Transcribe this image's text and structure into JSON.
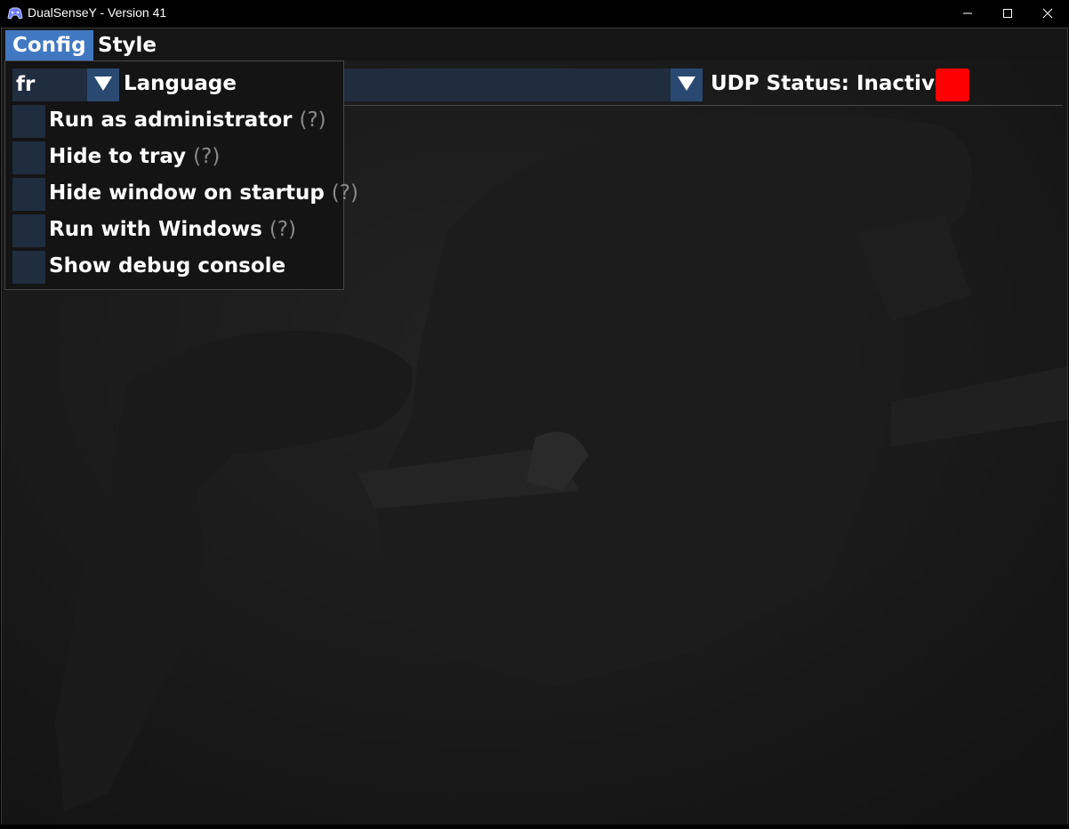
{
  "window": {
    "title": "DualSenseY - Version 41"
  },
  "menu": {
    "items": [
      {
        "label": "Config",
        "active": true
      },
      {
        "label": "Style",
        "active": false
      }
    ]
  },
  "toolbar": {
    "udp_status": "UDP Status: Inactive",
    "udp_color": "#ff0000"
  },
  "config_menu": {
    "language_value": "fr",
    "language_label": "Language",
    "options": [
      {
        "label": "Run as administrator",
        "help": "(?)",
        "checked": false
      },
      {
        "label": "Hide to tray",
        "help": "(?)",
        "checked": false
      },
      {
        "label": "Hide window on startup",
        "help": "(?)",
        "checked": false
      },
      {
        "label": "Run with Windows",
        "help": "(?)",
        "checked": false
      },
      {
        "label": "Show debug console",
        "help": "",
        "checked": false
      }
    ]
  },
  "colors": {
    "accent": "#4078c2",
    "frame_bg": "#1f2d3f",
    "button": "#2a4970"
  }
}
